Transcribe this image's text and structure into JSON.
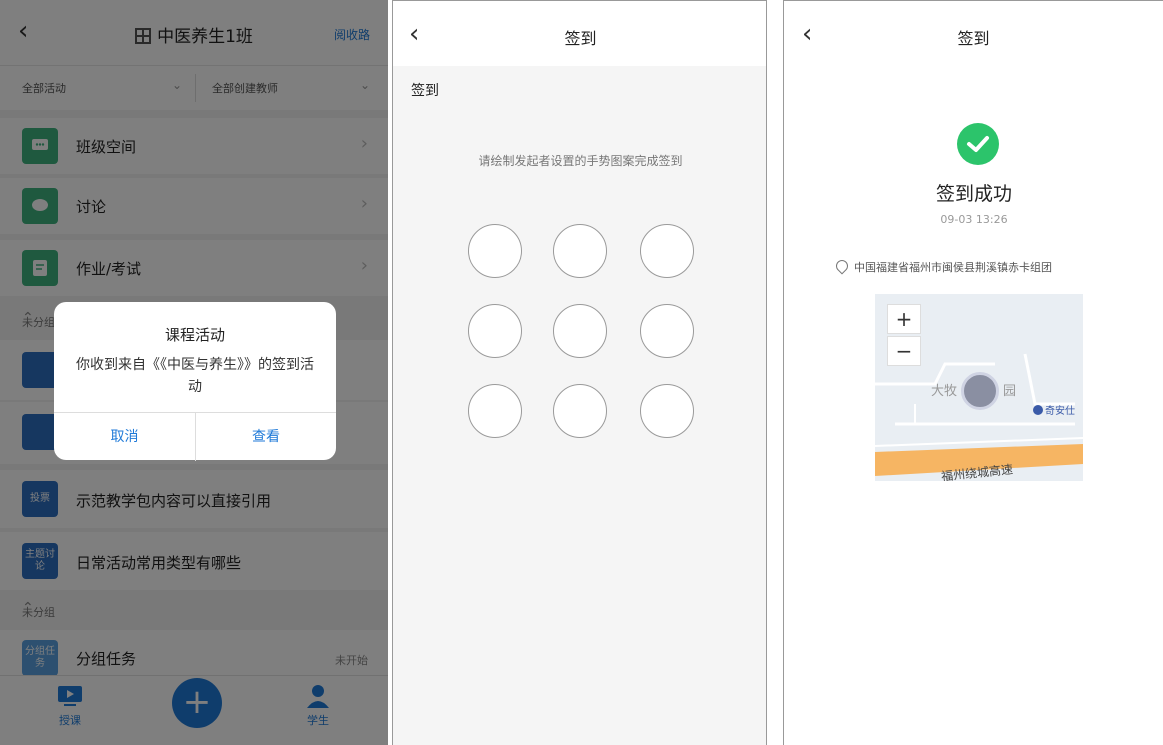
{
  "panel1": {
    "title": "中医养生1班",
    "right_action": "阅收路",
    "filters": [
      {
        "label": "全部活动"
      },
      {
        "label": "全部创建教师"
      }
    ],
    "rows": [
      {
        "icon": "chat-icon",
        "label": "班级空间",
        "color": "#3fb27f"
      },
      {
        "icon": "discussion-icon",
        "label": "讨论",
        "color": "#3fb27f"
      },
      {
        "icon": "homework-icon",
        "label": "作业/考试",
        "color": "#3fb27f"
      }
    ],
    "section_unfinished": "未分组",
    "list_rows": [
      {
        "icon_text": "投票",
        "label": "示范教学包内容可以直接引用",
        "color": "#2c6fc0"
      },
      {
        "icon_text": "主题讨论",
        "label": "日常活动常用类型有哪些",
        "color": "#2c6fc0"
      }
    ],
    "group_row": {
      "icon_text": "分组任务",
      "label": "分组任务",
      "status": "未开始",
      "color": "#5aa0e0"
    },
    "tabs": [
      {
        "label": "授课"
      },
      {
        "label": "学生"
      }
    ],
    "dialog": {
      "title": "课程活动",
      "message": "你收到来自《《中医与养生》》的签到活动",
      "cancel": "取消",
      "view": "查看"
    }
  },
  "panel2": {
    "title": "签到",
    "subtitle": "签到",
    "hint": "请绘制发起者设置的手势图案完成签到"
  },
  "panel3": {
    "title": "签到",
    "success_title": "签到成功",
    "time": "09-03 13:26",
    "location": "中国福建省福州市闽侯县荆溪镇赤卡组团",
    "map": {
      "zoom_in": "+",
      "zoom_out": "−",
      "label_district": "大牧",
      "label_suffix": "园",
      "poi": "奇安仕",
      "highway": "福州绕城高速"
    }
  },
  "colors": {
    "accent": "#1f7ad8",
    "success": "#2cc46b"
  }
}
